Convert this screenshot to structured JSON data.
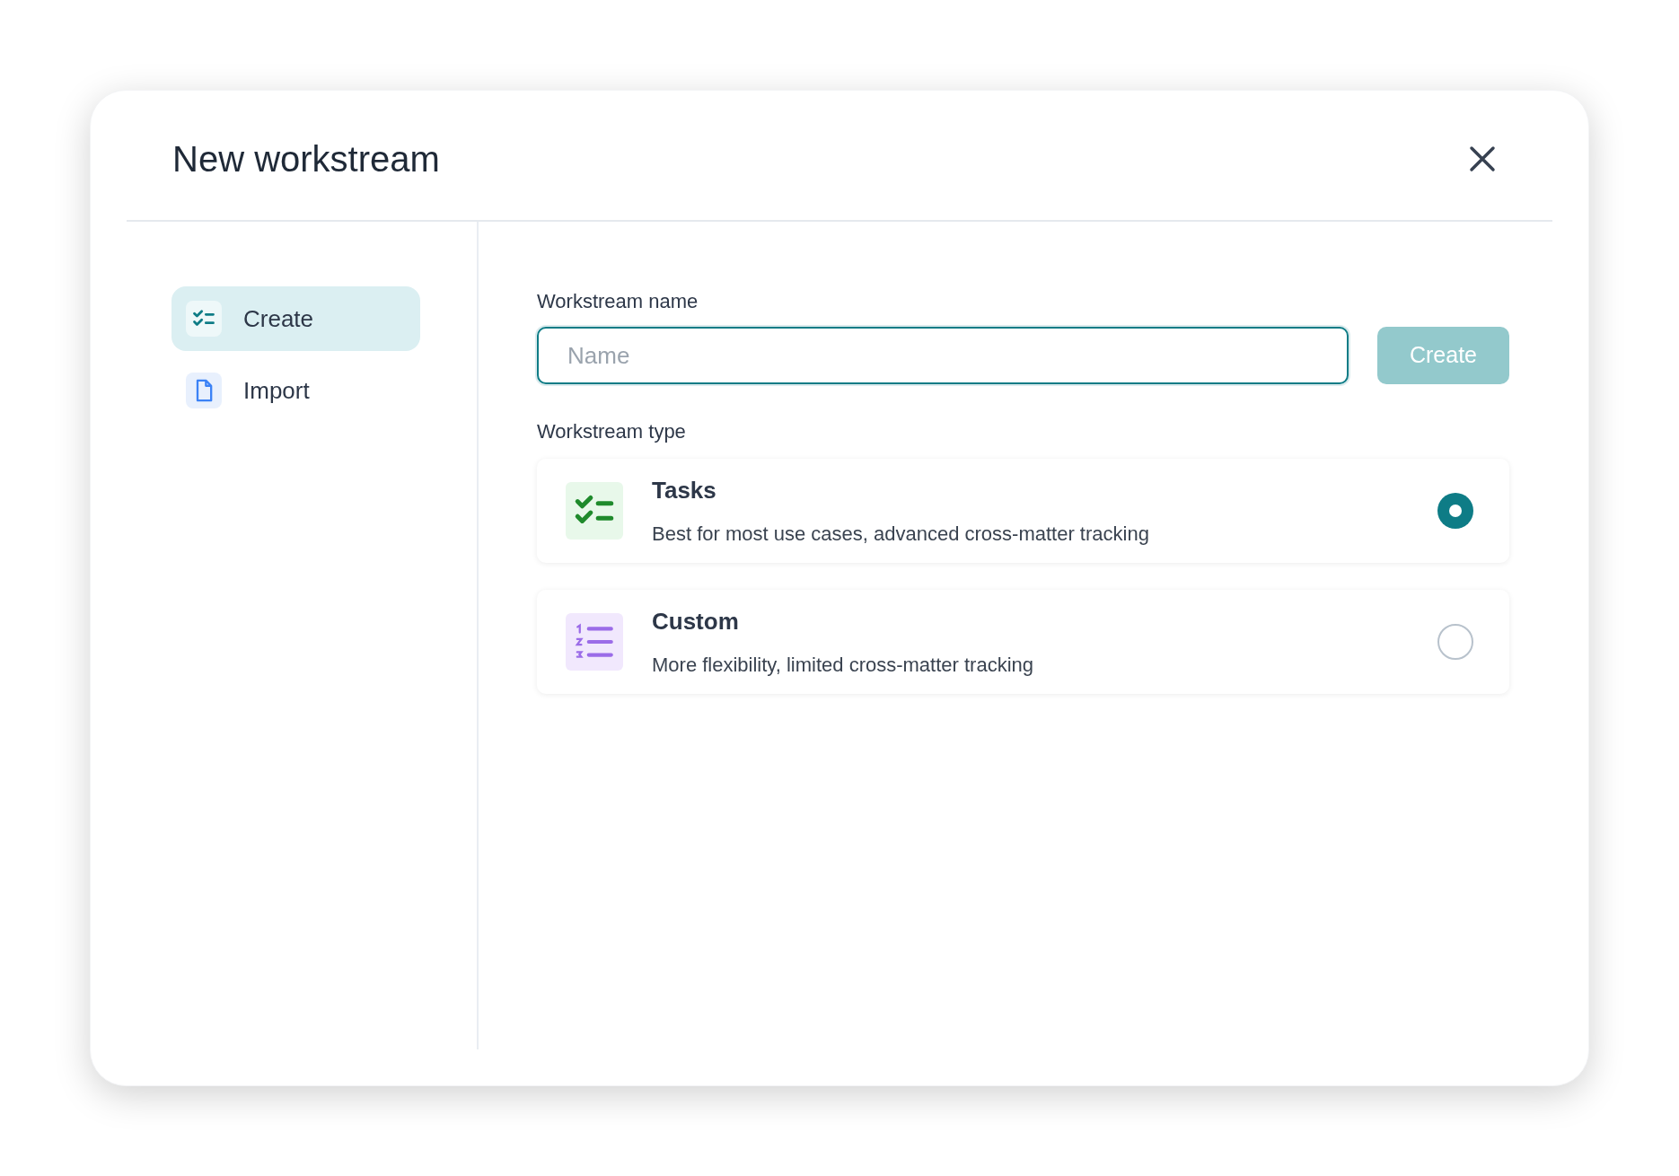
{
  "dialog": {
    "title": "New workstream"
  },
  "sidebar": {
    "items": [
      {
        "label": "Create",
        "kind": "checklist",
        "selected": true
      },
      {
        "label": "Import",
        "kind": "document",
        "selected": false
      }
    ]
  },
  "name_field": {
    "label": "Workstream name",
    "placeholder": "Name",
    "focused": true
  },
  "create_button": {
    "label": "Create",
    "disabled": true
  },
  "type_section": {
    "label": "Workstream type",
    "options": [
      {
        "kind": "checklist",
        "title": "Tasks",
        "description": "Best for most use cases, advanced cross-matter tracking",
        "selected": true
      },
      {
        "kind": "numbered",
        "title": "Custom",
        "description": "More flexibility, limited cross-matter tracking",
        "selected": false
      }
    ]
  }
}
